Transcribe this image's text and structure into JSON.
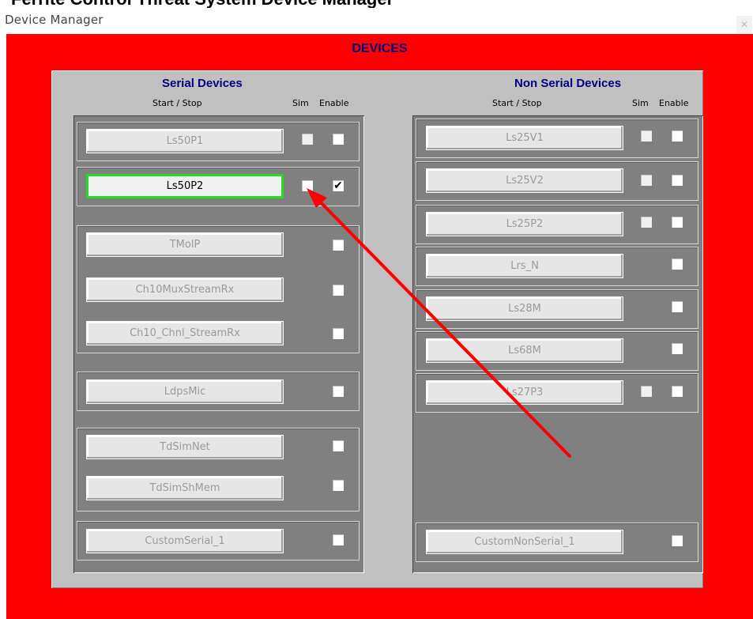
{
  "top_cut_text": "Ferrite Control Threat System Device Manager",
  "window": {
    "title": "Device Manager",
    "close": "✕"
  },
  "heading": "DEVICES",
  "serial": {
    "title": "Serial Devices",
    "col_start": "Start / Stop",
    "col_sim": "Sim",
    "col_enable": "Enable",
    "devices": [
      {
        "label": "Ls50P1",
        "sim": false,
        "enable": false,
        "active": false
      },
      {
        "label": "Ls50P2",
        "sim": false,
        "enable": true,
        "active": true
      },
      {
        "label": "TMolP",
        "enable": false
      },
      {
        "label": "Ch10MuxStreamRx",
        "enable": false
      },
      {
        "label": "Ch10_Chnl_StreamRx",
        "enable": false
      },
      {
        "label": "LdpsMic",
        "enable": false
      },
      {
        "label": "TdSimNet",
        "enable": false
      },
      {
        "label": "TdSimShMem",
        "enable": false
      },
      {
        "label": "CustomSerial_1",
        "enable": false
      }
    ]
  },
  "nonserial": {
    "title": "Non Serial Devices",
    "col_start": "Start / Stop",
    "col_sim": "Sim",
    "col_enable": "Enable",
    "devices": [
      {
        "label": "Ls25V1",
        "sim": false,
        "enable": false
      },
      {
        "label": "Ls25V2",
        "sim": false,
        "enable": false
      },
      {
        "label": "Ls25P2",
        "sim": false,
        "enable": false
      },
      {
        "label": "Lrs_N",
        "enable": false
      },
      {
        "label": "Ls28M",
        "enable": false
      },
      {
        "label": "Ls68M",
        "enable": false
      },
      {
        "label": "Ls27P3",
        "sim": false,
        "enable": false
      },
      {
        "label": "CustomNonSerial_1",
        "enable": false
      }
    ]
  },
  "annotation_color": "#ff0000",
  "check_glyph": "✔"
}
